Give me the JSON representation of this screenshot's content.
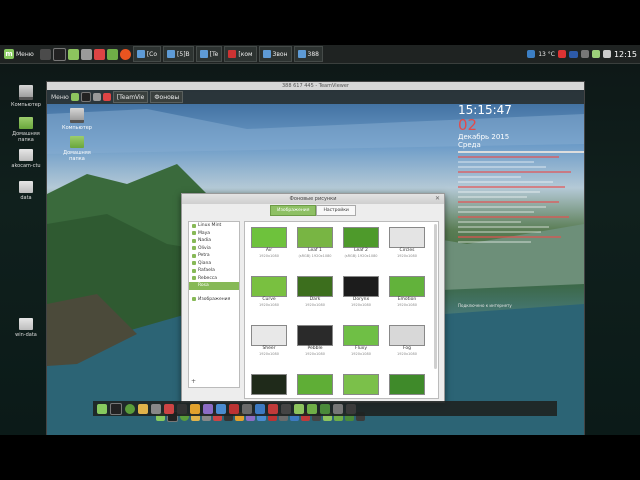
{
  "panel": {
    "menu_label": "Меню",
    "tasks": [
      "[Co",
      "[5]B",
      "[Te",
      "[ком",
      "Звон",
      "388"
    ],
    "temperature": "13 °C",
    "clock": "12:15"
  },
  "desktop_icons": [
    "Компьютер",
    "Домашняя папка",
    "akocam-ctu",
    "data",
    "win-data"
  ],
  "vm": {
    "window_title": "388 617 445 - TeamViewer",
    "menu_label": "Меню",
    "tasks": [
      "[TeamVie",
      "Фоновы"
    ],
    "desktop_icons": [
      "Компьютер",
      "Домашняя папка"
    ],
    "conky": {
      "time": "15:15:47",
      "day": "02",
      "month": "Декабрь 2015",
      "weekday": "Среда",
      "footer": "Подключено к интернету"
    }
  },
  "dialog": {
    "title": "Фоновые рисунки",
    "tabs": [
      "Изображения",
      "Настройки"
    ],
    "sidebar": [
      {
        "label": "Linux Mint",
        "selected": false
      },
      {
        "label": "Maya",
        "selected": false
      },
      {
        "label": "Nadia",
        "selected": false
      },
      {
        "label": "Olivia",
        "selected": false
      },
      {
        "label": "Petra",
        "selected": false
      },
      {
        "label": "Qiana",
        "selected": false
      },
      {
        "label": "Rafaela",
        "selected": false
      },
      {
        "label": "Rebecca",
        "selected": false
      },
      {
        "label": "Rosa",
        "selected": true
      },
      {
        "label": "Изображения",
        "selected": false
      }
    ],
    "wallpapers": [
      {
        "name": "Air",
        "size": "1920x1080",
        "color": "#6ec23c"
      },
      {
        "name": "Leaf 1",
        "size": "(sRGB) 1920x1080",
        "color": "#78b543"
      },
      {
        "name": "Leaf 2",
        "size": "(sRGB) 1920x1080",
        "color": "#4e9a2b"
      },
      {
        "name": "Circles",
        "size": "1920x1080",
        "color": "#e4e4e4"
      },
      {
        "name": "Curve",
        "size": "1920x1080",
        "color": "#79c040"
      },
      {
        "name": "Dark",
        "size": "1920x1080",
        "color": "#3c6e1d"
      },
      {
        "name": "Dorynx",
        "size": "1920x1080",
        "color": "#1c1c1c"
      },
      {
        "name": "Emotion",
        "size": "1920x1080",
        "color": "#62b23b"
      },
      {
        "name": "Sheer",
        "size": "1920x1080",
        "color": "#e8e8e8"
      },
      {
        "name": "Pebble",
        "size": "1920x1080",
        "color": "#2a2a2a"
      },
      {
        "name": "Fluxy",
        "size": "1920x1080",
        "color": "#6fbf45"
      },
      {
        "name": "Fog",
        "size": "1920x1080",
        "color": "#d8d8d8"
      },
      {
        "name": "",
        "size": "",
        "color": "#1f2a1a"
      },
      {
        "name": "",
        "size": "",
        "color": "#5fae36"
      },
      {
        "name": "",
        "size": "",
        "color": "#7bc04a"
      },
      {
        "name": "",
        "size": "",
        "color": "#3f8a2a"
      }
    ]
  }
}
